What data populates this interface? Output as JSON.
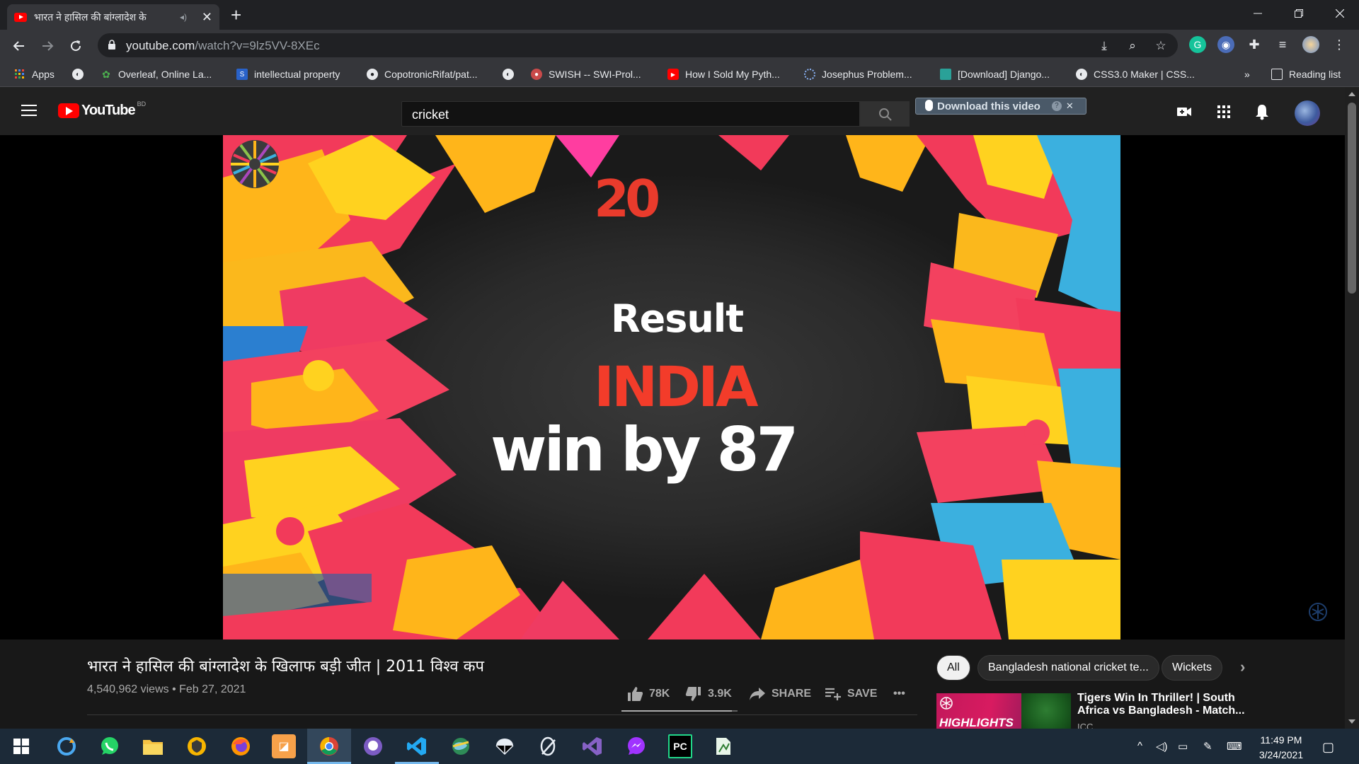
{
  "browser": {
    "tab_title": "भारत ने हासिल की बांग्लादेश के",
    "tab_close": "✕",
    "new_tab": "+",
    "url_host": "youtube.com",
    "url_path": "/watch?v=9lz5VV-8XEc",
    "bookmarks": [
      {
        "label": "Apps",
        "icon": "apps-grid-icon"
      },
      {
        "label": "",
        "icon": "globe-icon"
      },
      {
        "label": "Overleaf, Online La...",
        "icon": "overleaf-icon"
      },
      {
        "label": "intellectual property",
        "icon": "bookmark-s-icon"
      },
      {
        "label": "CopotronicRifat/pat...",
        "icon": "github-icon"
      },
      {
        "label": "",
        "icon": "globe-icon"
      },
      {
        "label": "SWISH -- SWI-Prol...",
        "icon": "swish-icon"
      },
      {
        "label": "How I Sold My Pyth...",
        "icon": "youtube-icon"
      },
      {
        "label": "Josephus Problem...",
        "icon": "loading-icon"
      },
      {
        "label": "[Download] Django...",
        "icon": "site-icon"
      },
      {
        "label": "CSS3.0 Maker | CSS...",
        "icon": "globe-icon"
      }
    ],
    "more_bookmarks": "»",
    "reading_list": "Reading list"
  },
  "youtube": {
    "logo_text": "YouTube",
    "country_code": "BD",
    "search_query": "cricket",
    "download_label": "Download this video",
    "download_help": "?",
    "download_close": "✕"
  },
  "video": {
    "frame_logo_digits": "20",
    "frame_line1": "Result",
    "frame_line2": "INDIA",
    "frame_line3": "win by 87",
    "title": "भारत ने हासिल की बांग्लादेश के खिलाफ बड़ी जीत | 2011 विश्व कप",
    "meta": "4,540,962 views • Feb 27, 2021",
    "likes": "78K",
    "dislikes": "3.9K",
    "like_ratio": 0.95,
    "share": "SHARE",
    "save": "SAVE",
    "more": "•••"
  },
  "sidebar": {
    "chips": [
      "All",
      "Bangladesh national cricket te...",
      "Wickets"
    ],
    "chip_next": "›",
    "recommendation": {
      "title": "Tigers Win In Thriller! | South Africa vs Bangladesh - Match...",
      "channel": "ICC",
      "thumb_text": "HIGHLIGHTS"
    }
  },
  "taskbar": {
    "time": "11:49 PM",
    "date": "3/24/2021"
  },
  "colors": {
    "yt_red": "#ff0000",
    "frame_red": "#f33c2a",
    "taskbar": "#1c2a38"
  }
}
